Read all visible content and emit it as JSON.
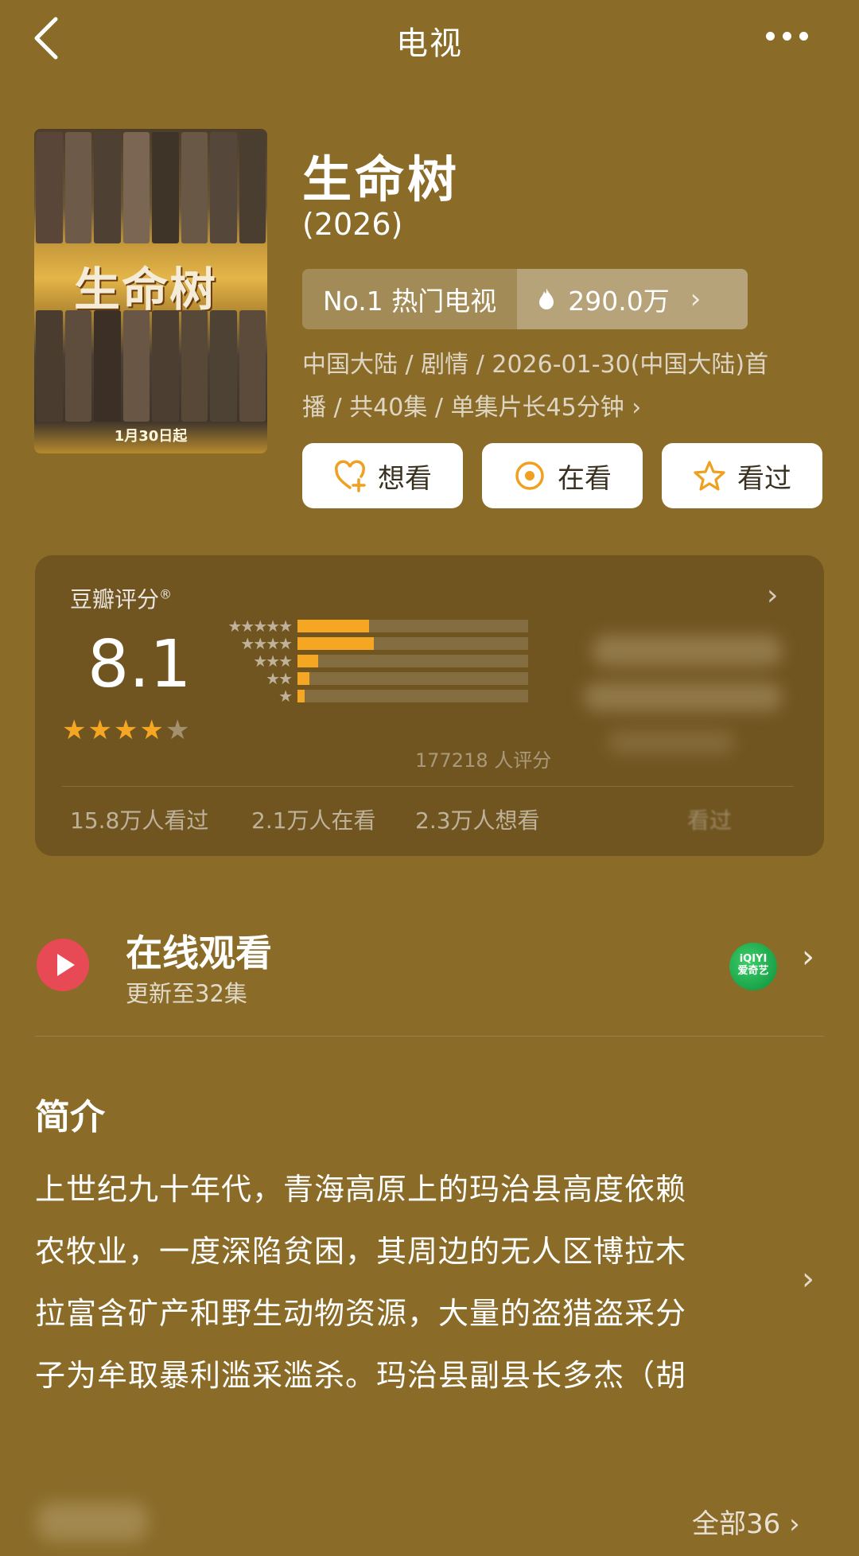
{
  "header": {
    "title": "电视"
  },
  "poster": {
    "title_art": "生命树",
    "date_text": "1月30日起"
  },
  "info": {
    "title": "生命树",
    "year": "(2026)",
    "rank_label": "No.1 热门电视",
    "heat_value": "290.0万",
    "meta_line1": "中国大陆 / 剧情 / 2026-01-30(中国大陆)首",
    "meta_line2": "播 / 共40集 / 单集片长45分钟 ›"
  },
  "actions": [
    {
      "label": "想看",
      "icon": "heart-plus-icon"
    },
    {
      "label": "在看",
      "icon": "target-icon"
    },
    {
      "label": "看过",
      "icon": "star-outline-icon"
    }
  ],
  "rating": {
    "label": "豆瓣评分",
    "registered_mark": "®",
    "score": "8.1",
    "stars_on": 4,
    "count_text": "177218 人评分",
    "distribution": [
      {
        "stars": "★★★★★",
        "fraction": 0.31
      },
      {
        "stars": "★★★★",
        "fraction": 0.33
      },
      {
        "stars": "★★★",
        "fraction": 0.09
      },
      {
        "stars": "★★",
        "fraction": 0.05
      },
      {
        "stars": "★",
        "fraction": 0.03
      }
    ],
    "stats": [
      "15.8万人看过",
      "2.1万人在看",
      "2.3万人想看"
    ],
    "blurred_label": "看过"
  },
  "online": {
    "title": "在线观看",
    "subtitle": "更新至32集",
    "provider_logo": "iQIYI\n爱奇艺"
  },
  "synopsis": {
    "title": "简介",
    "lines": [
      "上世纪九十年代，青海高原上的玛治县高度依赖",
      "农牧业，一度深陷贫困，其周边的无人区博拉木",
      "拉富含矿产和野生动物资源，大量的盗猎盗采分",
      "子为牟取暴利滥采滥杀。玛治县副县长多杰（胡"
    ]
  },
  "footer": {
    "all_link": "全部36 ›"
  },
  "colors": {
    "background": "#8a6b28",
    "accent_star": "#f5a623",
    "play_red": "#e84a55",
    "iqiyi_green": "#1fae4b"
  }
}
